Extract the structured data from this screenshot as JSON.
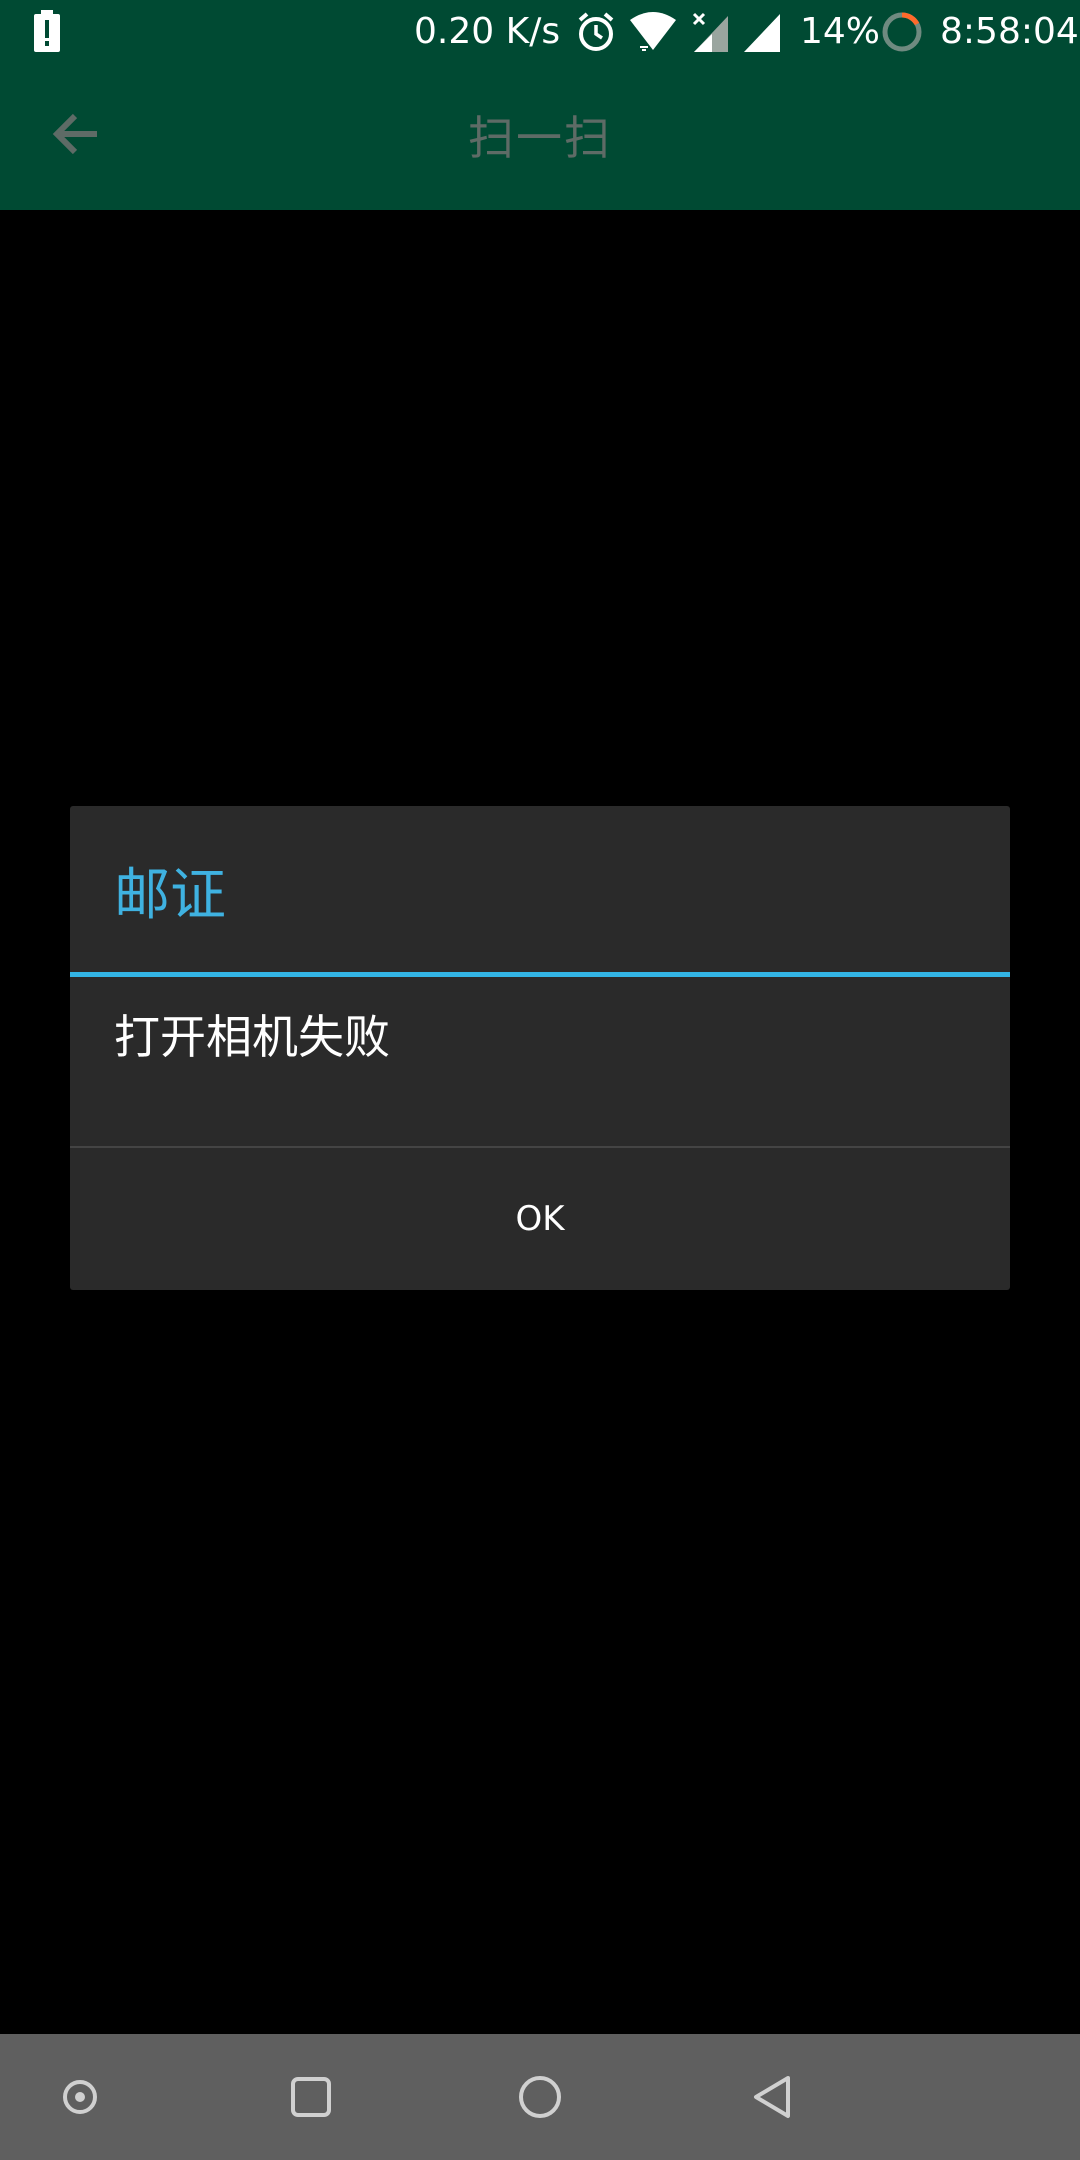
{
  "status_bar": {
    "net_speed": "0.20 K/s",
    "battery_percent": "14%",
    "time": "8:58:04",
    "icons": [
      "battery-alert-icon",
      "alarm-icon",
      "wifi-icon",
      "signal-no-data-icon",
      "signal-icon",
      "battery-ring-icon"
    ]
  },
  "app_bar": {
    "title": "扫一扫",
    "back_icon": "arrow-left-icon",
    "color": "#004a33"
  },
  "dialog": {
    "title": "邮证",
    "message": "打开相机失败",
    "ok_label": "OK",
    "accent_color": "#33b5e5"
  },
  "nav_bar": {
    "icons": [
      "assist-dot-icon",
      "recents-square-icon",
      "home-circle-icon",
      "back-triangle-icon"
    ]
  }
}
